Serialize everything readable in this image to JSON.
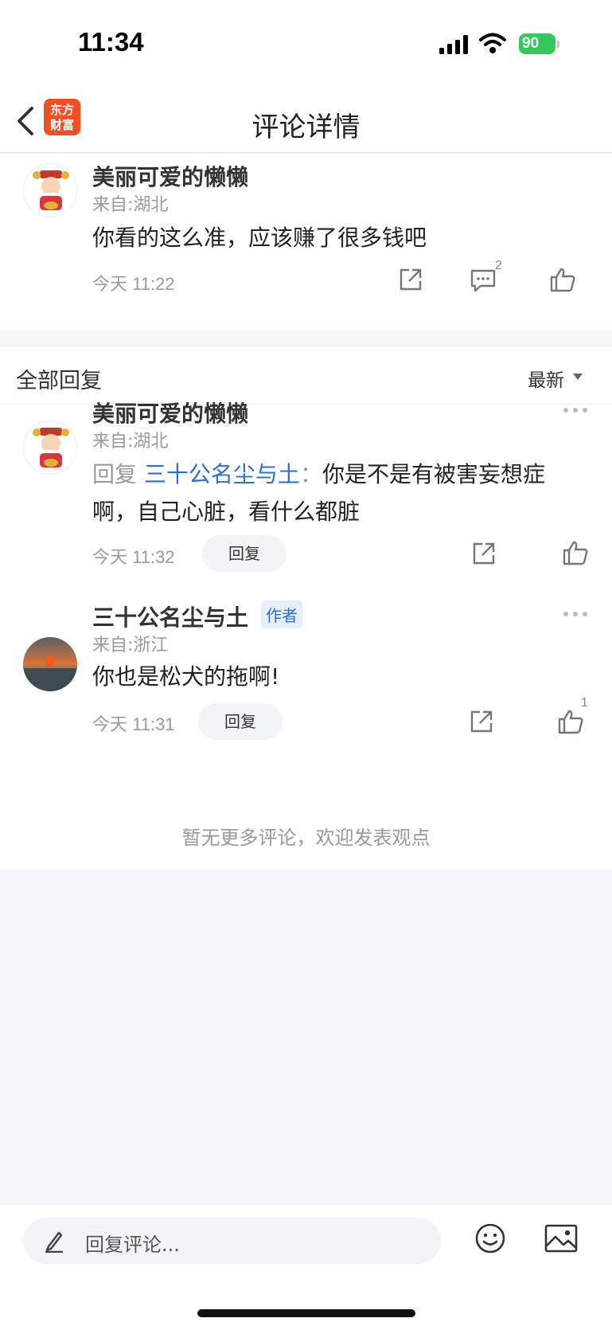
{
  "status_bar": {
    "time": "11:34",
    "battery": "90"
  },
  "nav": {
    "title": "评论详情",
    "logo_line1": "东方",
    "logo_line2": "财富"
  },
  "main_comment": {
    "username": "美丽可爱的懒懒",
    "location": "来自:湖北",
    "content": "你看的这么准，应该赚了很多钱吧",
    "time": "今天 11:22",
    "comment_count": "2"
  },
  "replies_section": {
    "header": "全部回复",
    "sort": "最新",
    "items": [
      {
        "username": "美丽可爱的懒懒",
        "location": "来自:湖北",
        "reply_prefix": "回复",
        "reply_to": "三十公名尘与土",
        "separator": "：",
        "content": "你是不是有被害妄想症啊，自己心脏，看什么都脏",
        "time": "今天 11:32",
        "reply_label": "回复"
      },
      {
        "username": "三十公名尘与土",
        "author_tag": "作者",
        "location": "来自:浙江",
        "content": "你也是松犬的拖啊!",
        "time": "今天 11:31",
        "reply_label": "回复",
        "like_count": "1"
      }
    ],
    "no_more": "暂无更多评论，欢迎发表观点"
  },
  "bottom_bar": {
    "placeholder": "回复评论..."
  },
  "colors": {
    "accent_blue": "#2b6fd6",
    "logo_orange": "#f25022",
    "battery_green": "#34c759"
  }
}
